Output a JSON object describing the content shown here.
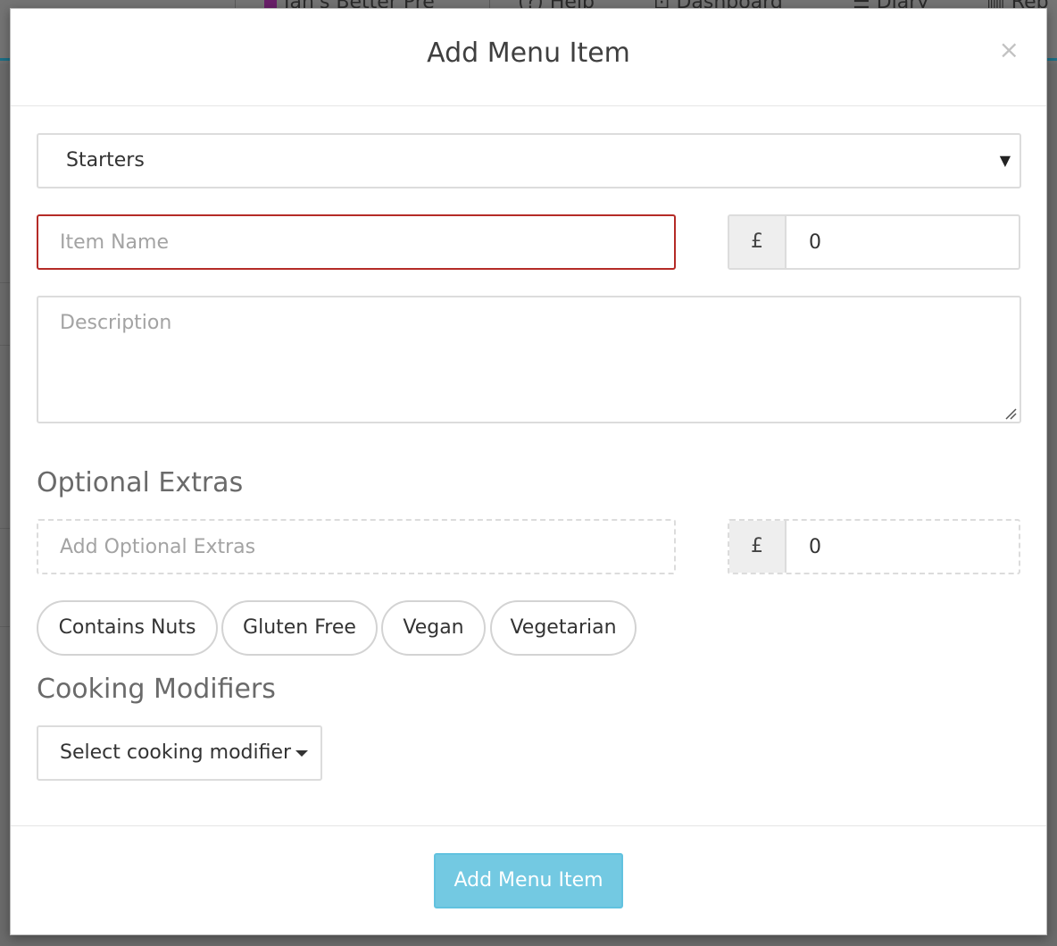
{
  "background_nav": {
    "items": [
      {
        "label": "Jan's Better Pre",
        "icon": "brand-square"
      },
      {
        "label": "(?) Help",
        "icon": "help-icon"
      },
      {
        "label": "Dashboard",
        "icon": "dashboard-icon"
      },
      {
        "label": "Diary",
        "icon": "list-icon"
      },
      {
        "label": "Rep",
        "icon": "chart-icon"
      }
    ]
  },
  "modal": {
    "title": "Add Menu Item",
    "close_icon": "×",
    "category": {
      "selected": "Starters",
      "caret": "▼"
    },
    "item_name": {
      "placeholder": "Item Name",
      "value": ""
    },
    "price": {
      "currency": "£",
      "value": "0"
    },
    "description": {
      "placeholder": "Description",
      "value": ""
    },
    "optional_extras": {
      "heading": "Optional Extras",
      "name_placeholder": "Add Optional Extras",
      "currency": "£",
      "price_value": "0"
    },
    "tags": [
      "Contains Nuts",
      "Gluten Free",
      "Vegan",
      "Vegetarian"
    ],
    "cooking_modifiers": {
      "heading": "Cooking Modifiers",
      "dropdown_label": "Select cooking modifier"
    },
    "submit_label": "Add Menu Item"
  },
  "colors": {
    "error_border": "#b52b27",
    "primary_button": "#5bc0de",
    "addon_bg": "#eeeeee"
  }
}
